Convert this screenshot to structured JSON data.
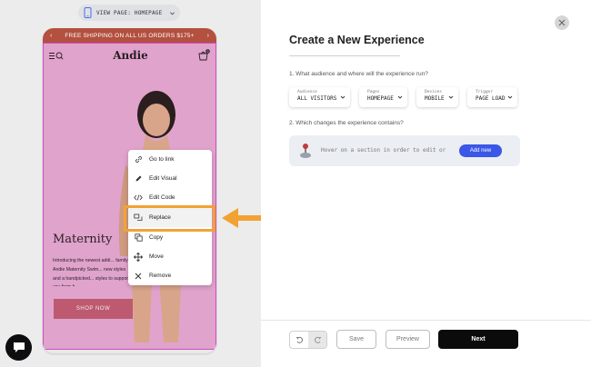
{
  "view_pill": {
    "label": "VIEW PAGE: HOMEPAGE",
    "icon": "phone-icon"
  },
  "preview": {
    "shipping_banner": "FREE SHIPPING ON ALL US ORDERS $175+",
    "logo": "Andie",
    "hero_title": "Maternity",
    "hero_text": "Introducing the newest addi... family: Andie Maternity Swim... new styles and a handpicked... styles to support you from b...",
    "shop_button": "SHOP NOW",
    "cart_count": "0",
    "highlight_color": "#f2a233"
  },
  "context_menu": {
    "items": [
      {
        "label": "Go to link",
        "icon": "link-icon"
      },
      {
        "label": "Edit Visual",
        "icon": "pencil-icon"
      },
      {
        "label": "Edit Code",
        "icon": "code-icon"
      },
      {
        "label": "Replace",
        "icon": "replace-icon"
      },
      {
        "label": "Copy",
        "icon": "copy-icon"
      },
      {
        "label": "Move",
        "icon": "move-icon"
      },
      {
        "label": "Remove",
        "icon": "close-icon"
      }
    ]
  },
  "panel": {
    "title": "Create a New Experience",
    "question1": "1. What audience and where will the experience run?",
    "question2": "2. Which changes the experience contains?",
    "dropdowns": [
      {
        "caption": "Audience",
        "value": "ALL VISITORS"
      },
      {
        "caption": "Pages",
        "value": "HOMEPAGE"
      },
      {
        "caption": "Devices",
        "value": "MOBILE"
      },
      {
        "caption": "Trigger",
        "value": "PAGE LOAD"
      }
    ],
    "hover_hint": "Hover on a section in order to edit or",
    "add_new": "Add new"
  },
  "footer": {
    "save": "Save",
    "preview": "Preview",
    "next": "Next"
  },
  "colors": {
    "accent_blue": "#3a57e8",
    "banner_red": "#b3503f",
    "site_pink": "#e0a3cc",
    "selection_magenta": "#d24cc4"
  }
}
